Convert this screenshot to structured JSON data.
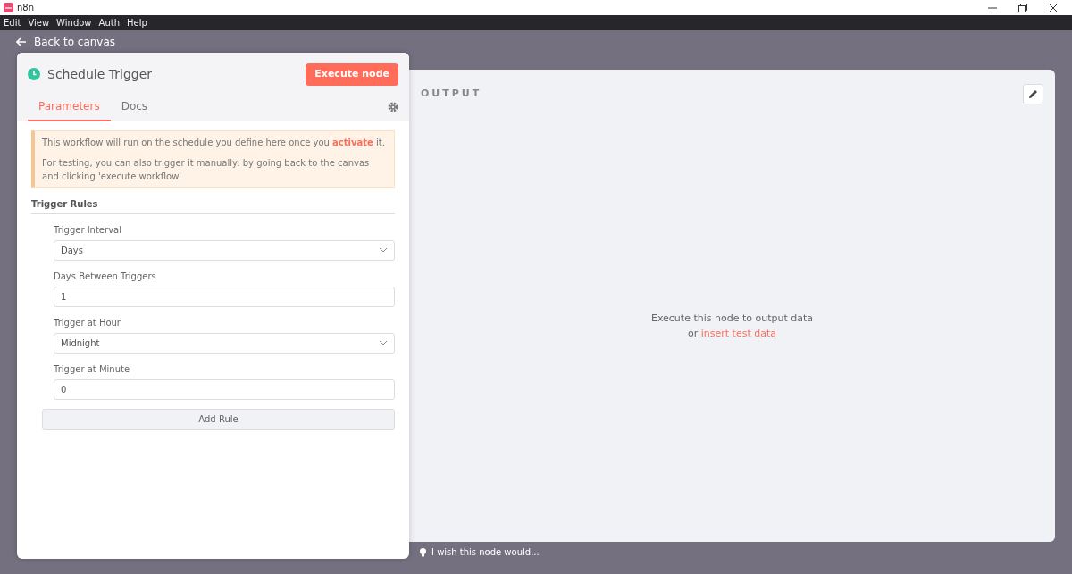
{
  "window": {
    "title": "n8n"
  },
  "menu": [
    "Edit",
    "View",
    "Window",
    "Auth",
    "Help"
  ],
  "back_link": "Back to canvas",
  "node": {
    "title": "Schedule Trigger",
    "execute_button": "Execute node",
    "tabs": [
      {
        "label": "Parameters",
        "selected": true
      },
      {
        "label": "Docs",
        "selected": false
      }
    ],
    "notice": {
      "line_1": "This workflow will run on the schedule you define here once you **activate** it.",
      "line_2": "For testing, you can also trigger it manually: by going back to the canvas and clicking 'execute workflow'"
    },
    "section": "Trigger Rules",
    "fields": [
      {
        "kind": "select",
        "label": "Trigger Interval",
        "value": "Days"
      },
      {
        "kind": "input",
        "label": "Days Between Triggers",
        "value": "1"
      },
      {
        "kind": "select",
        "label": "Trigger at Hour",
        "value": "Midnight"
      },
      {
        "kind": "input",
        "label": "Trigger at Minute",
        "value": "0"
      }
    ],
    "add_button": "Add Rule"
  },
  "output": {
    "title": "OUTPUT",
    "message": "Execute this node to output data",
    "alt_prefix": "or",
    "alt_link": "insert test data"
  },
  "feedback": "I wish this node would..."
}
